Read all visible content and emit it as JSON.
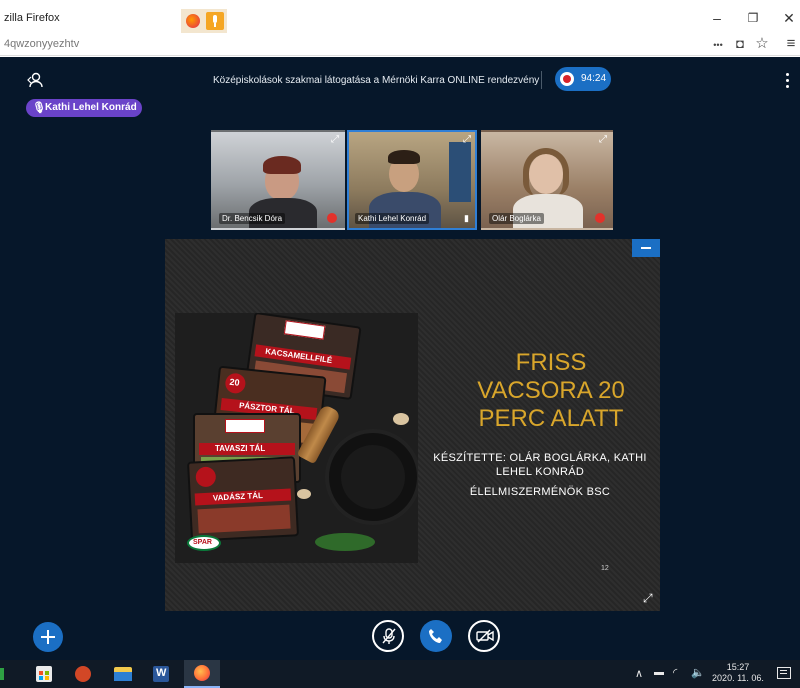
{
  "browser": {
    "window_title": "zilla Firefox",
    "url": "4qwzonyyezhtv",
    "win_minimize": "–",
    "win_restore": "❐",
    "win_close": "✕",
    "more_icon": "•••",
    "pocket_icon": "◘",
    "star_icon": "☆",
    "menu_icon": "≡"
  },
  "meeting": {
    "title": "Középiskolások szakmai látogatása a Mérnöki Karra ONLINE rendezvény",
    "timer": "94:24",
    "presenter_badge": "Kathi Lehel Konrád",
    "participants": [
      {
        "name": "Dr. Bencsik Dóra"
      },
      {
        "name": "Kathi Lehel Konrád"
      },
      {
        "name": "Olár Boglárka"
      }
    ],
    "slide": {
      "title_line1": "FRISS",
      "title_line2": "VACSORA 20",
      "title_line3": "PERC ALATT",
      "author_line1": "KÉSZÍTETTE: OLÁR BOGLÁRKA, KATHI",
      "author_line2": "LEHEL KONRÁD",
      "program": "ÉLELMISZERMÉNÖK BSC",
      "page_number": "12",
      "package_labels": [
        "KACSAMELLFILÉ",
        "PÁSZTOR TÁL",
        "TAVASZI TÁL",
        "VADÁSZ TÁL"
      ],
      "brand_label": "SPAR",
      "badge_20": "20"
    },
    "colors": {
      "accent": "#1b6fc4",
      "slide_title": "#d9a62b",
      "badge": "#6a43c9",
      "background": "#06172a"
    }
  },
  "taskbar": {
    "time": "15:27",
    "date": "2020. 11. 06."
  }
}
